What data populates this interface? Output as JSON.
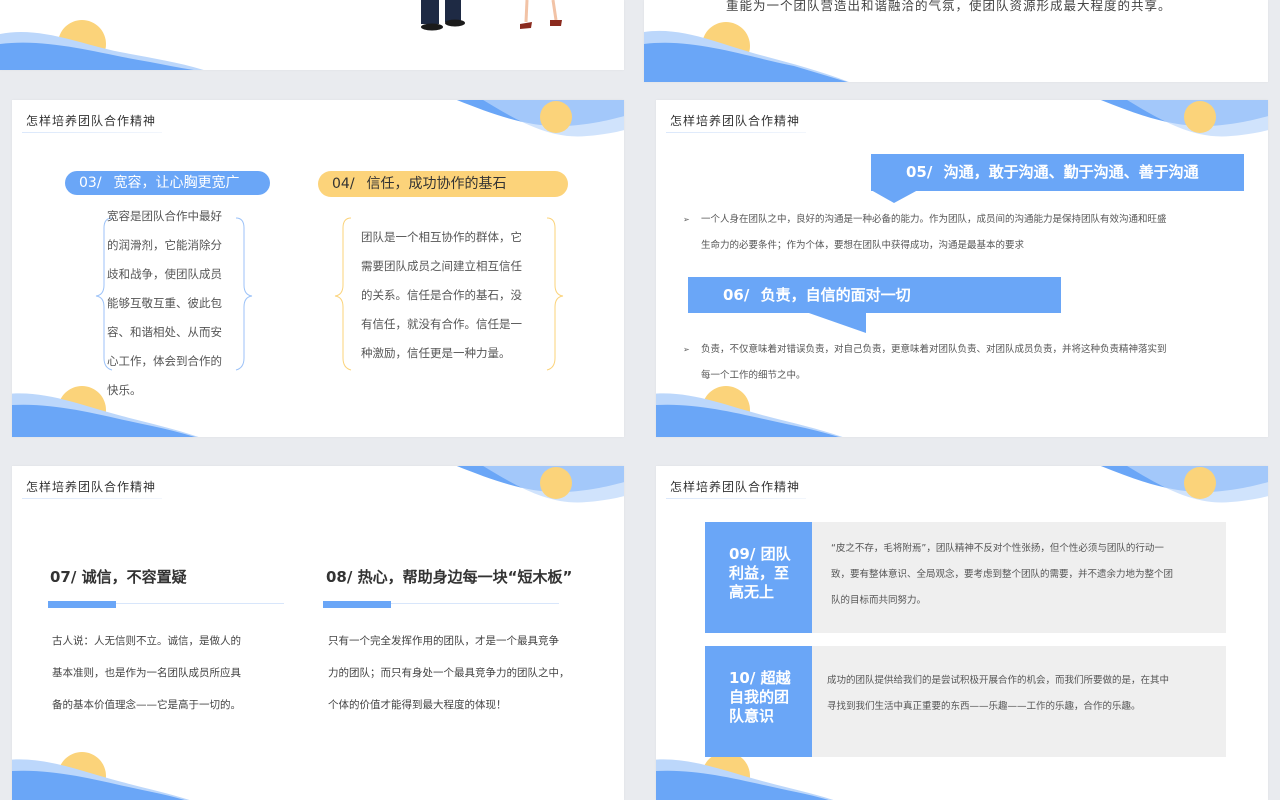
{
  "slide_title": "怎样培养团队合作精神",
  "top_right": {
    "text": "重能为一个团队营造出和谐融洽的气氛，使团队资源形成最大程度的共享。"
  },
  "slide_a": {
    "left": {
      "num": "03/",
      "title": "宽容，让心胸更宽广",
      "lines": [
        "宽容是团队合作中最好",
        "的润滑剂，它能消除分",
        "歧和战争，使团队成员",
        "能够互敬互重、彼此包",
        "容、和谐相处、从而安",
        "心工作，体会到合作的",
        "快乐。"
      ]
    },
    "right": {
      "num": "04/",
      "title": "信任，成功协作的基石",
      "lines": [
        "团队是一个相互协作的群体，它",
        "需要团队成员之间建立相互信任",
        "的关系。信任是合作的基石，没",
        "有信任，就没有合作。信任是一",
        "种激励，信任更是一种力量。"
      ]
    }
  },
  "slide_b": {
    "item1": {
      "num": "05/",
      "title": "沟通，敢于沟通、勤于沟通、善于沟通",
      "lines": [
        "一个人身在团队之中，良好的沟通是一种必备的能力。作为团队，成员间的沟通能力是保持团队有效沟通和旺盛",
        "生命力的必要条件；作为个体，要想在团队中获得成功，沟通是最基本的要求"
      ]
    },
    "item2": {
      "num": "06/",
      "title": "负责，自信的面对一切",
      "lines": [
        "负责，不仅意味着对错误负责，对自己负责，更意味着对团队负责、对团队成员负责，并将这种负责精神落实到",
        "每一个工作的细节之中。"
      ]
    }
  },
  "slide_c": {
    "left": {
      "num": "07/",
      "title": "诚信，不容置疑",
      "lines": [
        "古人说：人无信则不立。诚信，是做人的",
        "基本准则，也是作为一名团队成员所应具",
        "备的基本价值理念——它是高于一切的。"
      ]
    },
    "right": {
      "num": "08/",
      "title": "热心，帮助身边每一块“短木板”",
      "lines": [
        "只有一个完全发挥作用的团队，才是一个最具竞争",
        "力的团队；而只有身处一个最具竞争力的团队之中，",
        "个体的价值才能得到最大程度的体现！"
      ]
    }
  },
  "slide_d": {
    "item1": {
      "label_lines": [
        "09/ 团队",
        "利益，至",
        "高无上"
      ],
      "lines": [
        "“皮之不存，毛将附焉”，团队精神不反对个性张扬，但个性必须与团队的行动一",
        "致，要有整体意识、全局观念，要考虑到整个团队的需要，并不遗余力地为整个团",
        "队的目标而共同努力。"
      ]
    },
    "item2": {
      "label_lines": [
        "10/ 超越",
        "自我的团",
        "队意识"
      ],
      "lines": [
        "成功的团队提供给我们的是尝试积极开展合作的机会，而我们所要做的是，在其中",
        "寻找到我们生活中真正重要的东西——乐趣——工作的乐趣，合作的乐趣。"
      ]
    }
  },
  "colors": {
    "accent_blue": "#6aa6f7",
    "pale_blue": "#bcd7fb",
    "sun_yellow": "#fbd37a",
    "pill_yellow": "#fcd37a"
  }
}
